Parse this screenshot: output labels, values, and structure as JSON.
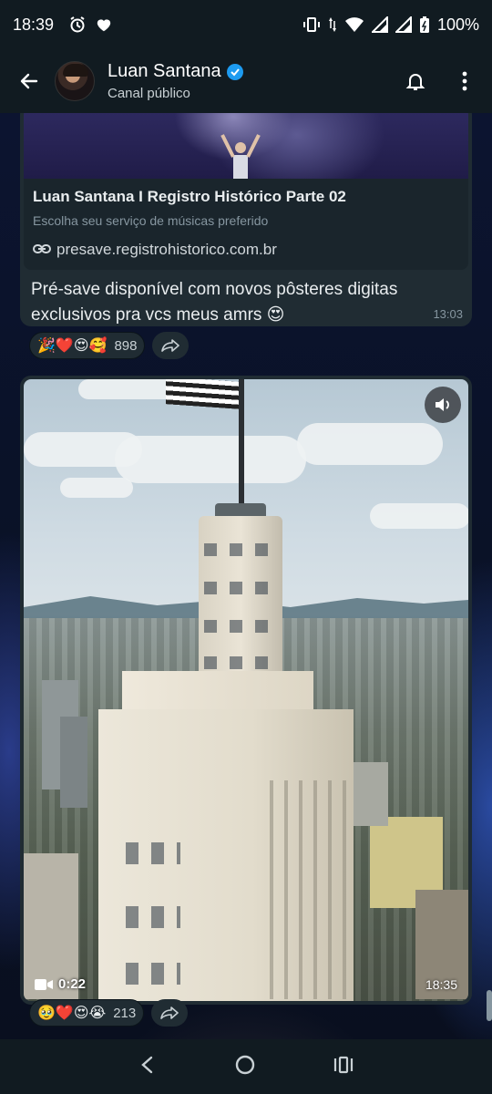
{
  "status_bar": {
    "time": "18:39",
    "battery": "100%",
    "icons": [
      "alarm-icon",
      "heart-icon",
      "vibrate-icon",
      "data-arrows-icon",
      "wifi-icon",
      "signal-icon",
      "signal-icon",
      "battery-icon"
    ]
  },
  "header": {
    "channel_name": "Luan Santana",
    "subtitle": "Canal público",
    "verified": true,
    "accent": "#1d9bf0"
  },
  "messages": [
    {
      "type": "link",
      "link_title": "Luan Santana I Registro Histórico Parte 02",
      "link_description": "Escolha seu serviço de músicas preferido",
      "link_url": "presave.registrohistorico.com.br",
      "text": "Pré-save disponível com novos pôsteres digitas exclusivos pra vcs meus amrs 😍",
      "time": "13:03",
      "reactions": {
        "emojis": "🎉❤️😍🥰",
        "count": "898"
      }
    },
    {
      "type": "video",
      "duration": "0:22",
      "time": "18:35",
      "reactions": {
        "emojis": "🥹❤️😍😭",
        "count": "213"
      }
    }
  ],
  "colors": {
    "bubble": "#202c33",
    "header_bg": "#111b21",
    "secondary_text": "#8696a0"
  }
}
